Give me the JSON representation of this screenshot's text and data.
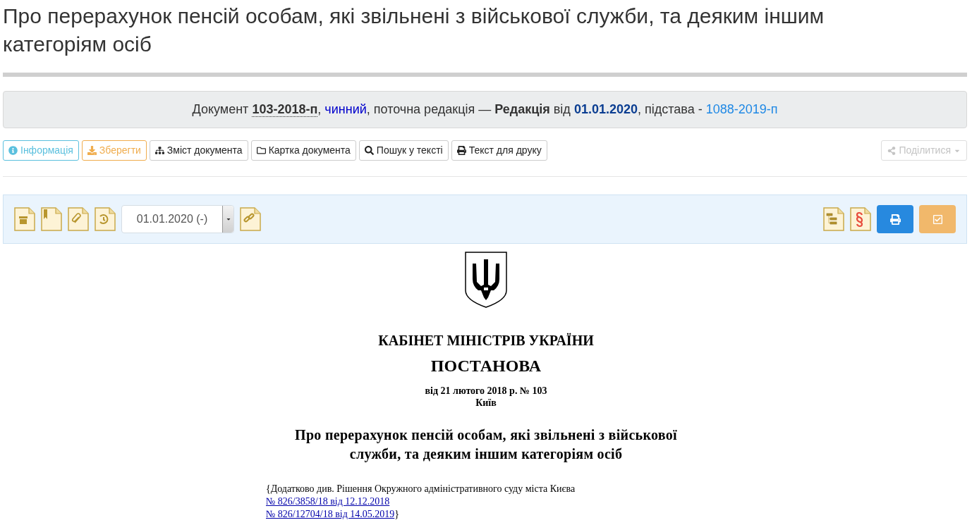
{
  "page_title": "Про перерахунок пенсій особам, які звільнені з військової служби, та деяким іншим категоріям осіб",
  "status_line": [
    {
      "kind": "text",
      "text": "Документ "
    },
    {
      "kind": "code",
      "text": "103-2018-п",
      "after": ", "
    },
    {
      "kind": "status",
      "text": "чинний"
    },
    {
      "kind": "text",
      "text": ", поточна редакція — "
    },
    {
      "kind": "bold",
      "text": "Редакція"
    },
    {
      "kind": "text",
      "text": " від "
    },
    {
      "kind": "date",
      "text": "01.01.2020"
    },
    {
      "kind": "text",
      "text": ", підстава - "
    },
    {
      "kind": "link",
      "text": "1088-2019-п"
    }
  ],
  "actions": [
    {
      "kind": "info",
      "label": "Інформація"
    },
    {
      "kind": "warning",
      "label": "Зберегти"
    },
    {
      "kind": "default",
      "label": "Зміст документа"
    },
    {
      "kind": "default",
      "label": "Картка документа"
    },
    {
      "kind": "default",
      "label": "Пошук у тексті"
    },
    {
      "kind": "default",
      "label": "Текст для друку"
    }
  ],
  "share": {
    "label": "Поділитися",
    "disabled": true
  },
  "toolbar": {
    "edition_select": "01.01.2020 (-)"
  },
  "document": {
    "issuer": "КАБІНЕТ МІНІСТРІВ УКРАЇНИ",
    "type": "ПОСТАНОВА",
    "date_line": "від 21 лютого 2018 р. № 103",
    "city": "Київ",
    "title_lines": [
      "Про перерахунок пенсій особам, які звільнені з військової",
      "служби, та деяким іншим категоріям осіб"
    ],
    "note": "{Додатково див. Рішення Окружного адміністративного суду міста Києва",
    "note_links": [
      "№ 826/3858/18 від 12.12.2018",
      "№ 826/12704/18 від 14.05.2019"
    ],
    "note_end": "}"
  }
}
